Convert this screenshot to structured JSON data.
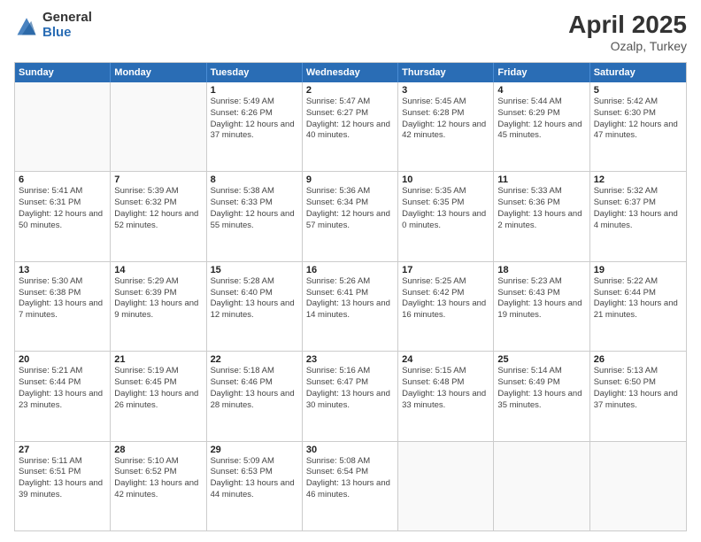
{
  "header": {
    "logo_general": "General",
    "logo_blue": "Blue",
    "title": "April 2025",
    "location": "Ozalp, Turkey"
  },
  "weekdays": [
    "Sunday",
    "Monday",
    "Tuesday",
    "Wednesday",
    "Thursday",
    "Friday",
    "Saturday"
  ],
  "weeks": [
    [
      {
        "date": "",
        "sunrise": "",
        "sunset": "",
        "daylight": ""
      },
      {
        "date": "",
        "sunrise": "",
        "sunset": "",
        "daylight": ""
      },
      {
        "date": "1",
        "sunrise": "Sunrise: 5:49 AM",
        "sunset": "Sunset: 6:26 PM",
        "daylight": "Daylight: 12 hours and 37 minutes."
      },
      {
        "date": "2",
        "sunrise": "Sunrise: 5:47 AM",
        "sunset": "Sunset: 6:27 PM",
        "daylight": "Daylight: 12 hours and 40 minutes."
      },
      {
        "date": "3",
        "sunrise": "Sunrise: 5:45 AM",
        "sunset": "Sunset: 6:28 PM",
        "daylight": "Daylight: 12 hours and 42 minutes."
      },
      {
        "date": "4",
        "sunrise": "Sunrise: 5:44 AM",
        "sunset": "Sunset: 6:29 PM",
        "daylight": "Daylight: 12 hours and 45 minutes."
      },
      {
        "date": "5",
        "sunrise": "Sunrise: 5:42 AM",
        "sunset": "Sunset: 6:30 PM",
        "daylight": "Daylight: 12 hours and 47 minutes."
      }
    ],
    [
      {
        "date": "6",
        "sunrise": "Sunrise: 5:41 AM",
        "sunset": "Sunset: 6:31 PM",
        "daylight": "Daylight: 12 hours and 50 minutes."
      },
      {
        "date": "7",
        "sunrise": "Sunrise: 5:39 AM",
        "sunset": "Sunset: 6:32 PM",
        "daylight": "Daylight: 12 hours and 52 minutes."
      },
      {
        "date": "8",
        "sunrise": "Sunrise: 5:38 AM",
        "sunset": "Sunset: 6:33 PM",
        "daylight": "Daylight: 12 hours and 55 minutes."
      },
      {
        "date": "9",
        "sunrise": "Sunrise: 5:36 AM",
        "sunset": "Sunset: 6:34 PM",
        "daylight": "Daylight: 12 hours and 57 minutes."
      },
      {
        "date": "10",
        "sunrise": "Sunrise: 5:35 AM",
        "sunset": "Sunset: 6:35 PM",
        "daylight": "Daylight: 13 hours and 0 minutes."
      },
      {
        "date": "11",
        "sunrise": "Sunrise: 5:33 AM",
        "sunset": "Sunset: 6:36 PM",
        "daylight": "Daylight: 13 hours and 2 minutes."
      },
      {
        "date": "12",
        "sunrise": "Sunrise: 5:32 AM",
        "sunset": "Sunset: 6:37 PM",
        "daylight": "Daylight: 13 hours and 4 minutes."
      }
    ],
    [
      {
        "date": "13",
        "sunrise": "Sunrise: 5:30 AM",
        "sunset": "Sunset: 6:38 PM",
        "daylight": "Daylight: 13 hours and 7 minutes."
      },
      {
        "date": "14",
        "sunrise": "Sunrise: 5:29 AM",
        "sunset": "Sunset: 6:39 PM",
        "daylight": "Daylight: 13 hours and 9 minutes."
      },
      {
        "date": "15",
        "sunrise": "Sunrise: 5:28 AM",
        "sunset": "Sunset: 6:40 PM",
        "daylight": "Daylight: 13 hours and 12 minutes."
      },
      {
        "date": "16",
        "sunrise": "Sunrise: 5:26 AM",
        "sunset": "Sunset: 6:41 PM",
        "daylight": "Daylight: 13 hours and 14 minutes."
      },
      {
        "date": "17",
        "sunrise": "Sunrise: 5:25 AM",
        "sunset": "Sunset: 6:42 PM",
        "daylight": "Daylight: 13 hours and 16 minutes."
      },
      {
        "date": "18",
        "sunrise": "Sunrise: 5:23 AM",
        "sunset": "Sunset: 6:43 PM",
        "daylight": "Daylight: 13 hours and 19 minutes."
      },
      {
        "date": "19",
        "sunrise": "Sunrise: 5:22 AM",
        "sunset": "Sunset: 6:44 PM",
        "daylight": "Daylight: 13 hours and 21 minutes."
      }
    ],
    [
      {
        "date": "20",
        "sunrise": "Sunrise: 5:21 AM",
        "sunset": "Sunset: 6:44 PM",
        "daylight": "Daylight: 13 hours and 23 minutes."
      },
      {
        "date": "21",
        "sunrise": "Sunrise: 5:19 AM",
        "sunset": "Sunset: 6:45 PM",
        "daylight": "Daylight: 13 hours and 26 minutes."
      },
      {
        "date": "22",
        "sunrise": "Sunrise: 5:18 AM",
        "sunset": "Sunset: 6:46 PM",
        "daylight": "Daylight: 13 hours and 28 minutes."
      },
      {
        "date": "23",
        "sunrise": "Sunrise: 5:16 AM",
        "sunset": "Sunset: 6:47 PM",
        "daylight": "Daylight: 13 hours and 30 minutes."
      },
      {
        "date": "24",
        "sunrise": "Sunrise: 5:15 AM",
        "sunset": "Sunset: 6:48 PM",
        "daylight": "Daylight: 13 hours and 33 minutes."
      },
      {
        "date": "25",
        "sunrise": "Sunrise: 5:14 AM",
        "sunset": "Sunset: 6:49 PM",
        "daylight": "Daylight: 13 hours and 35 minutes."
      },
      {
        "date": "26",
        "sunrise": "Sunrise: 5:13 AM",
        "sunset": "Sunset: 6:50 PM",
        "daylight": "Daylight: 13 hours and 37 minutes."
      }
    ],
    [
      {
        "date": "27",
        "sunrise": "Sunrise: 5:11 AM",
        "sunset": "Sunset: 6:51 PM",
        "daylight": "Daylight: 13 hours and 39 minutes."
      },
      {
        "date": "28",
        "sunrise": "Sunrise: 5:10 AM",
        "sunset": "Sunset: 6:52 PM",
        "daylight": "Daylight: 13 hours and 42 minutes."
      },
      {
        "date": "29",
        "sunrise": "Sunrise: 5:09 AM",
        "sunset": "Sunset: 6:53 PM",
        "daylight": "Daylight: 13 hours and 44 minutes."
      },
      {
        "date": "30",
        "sunrise": "Sunrise: 5:08 AM",
        "sunset": "Sunset: 6:54 PM",
        "daylight": "Daylight: 13 hours and 46 minutes."
      },
      {
        "date": "",
        "sunrise": "",
        "sunset": "",
        "daylight": ""
      },
      {
        "date": "",
        "sunrise": "",
        "sunset": "",
        "daylight": ""
      },
      {
        "date": "",
        "sunrise": "",
        "sunset": "",
        "daylight": ""
      }
    ]
  ]
}
